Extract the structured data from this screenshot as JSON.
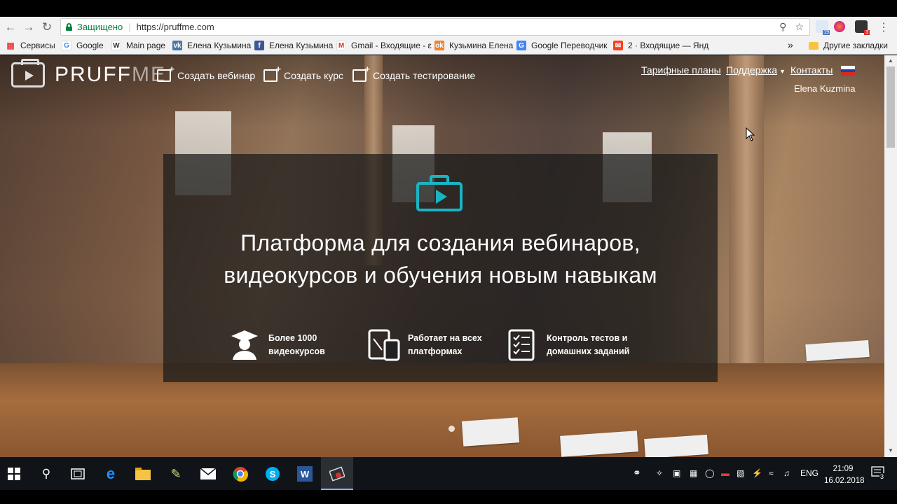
{
  "browser": {
    "secure_label": "Защищено",
    "url": "https://pruffme.com",
    "bookmarks": [
      {
        "label": "Сервисы",
        "icon": "apps-grid-icon"
      },
      {
        "label": "Google",
        "icon": "google-icon"
      },
      {
        "label": "Main page",
        "icon": "wikipedia-icon"
      },
      {
        "label": "Елена Кузьмина",
        "icon": "vk-icon"
      },
      {
        "label": "Елена Кузьмина",
        "icon": "facebook-icon"
      },
      {
        "label": "Gmail - Входящие - ε",
        "icon": "gmail-icon"
      },
      {
        "label": "Кузьмина Елена",
        "icon": "ok-icon"
      },
      {
        "label": "Google Переводчик",
        "icon": "translate-icon"
      },
      {
        "label": "2 · Входящие — Янд",
        "icon": "yandex-mail-icon"
      }
    ],
    "more_bookmarks": "»",
    "other_bookmarks": "Другие закладки",
    "ext_badge_1": "19",
    "ext_badge_2": "3"
  },
  "site": {
    "logo_main": "PRUFF",
    "logo_suffix": "ME",
    "nav": [
      {
        "label": "Создать вебинар",
        "icon": "create-webinar-icon"
      },
      {
        "label": "Создать курс",
        "icon": "create-course-icon"
      },
      {
        "label": "Создать тестирование",
        "icon": "create-test-icon"
      }
    ],
    "right_nav": {
      "pricing": "Тарифные планы",
      "support": "Поддержка",
      "contacts": "Контакты"
    },
    "user_name": "Elena Kuzmina"
  },
  "hero": {
    "title_line1": "Платформа для создания вебинаров,",
    "title_line2": "видеокурсов и обучения новым навыкам",
    "features": [
      {
        "line1": "Более 1000",
        "line2": "видеокурсов",
        "icon": "graduate-icon"
      },
      {
        "line1": "Работает на всех",
        "line2": "платформах",
        "icon": "devices-icon"
      },
      {
        "line1": "Контроль тестов и",
        "line2": "домашних заданий",
        "icon": "checklist-icon"
      }
    ]
  },
  "taskbar": {
    "lang": "ENG",
    "time": "21:09",
    "date": "16.02.2018",
    "notifications": "3"
  },
  "colors": {
    "accent": "#1ab5c4",
    "secure_green": "#0b8043"
  }
}
